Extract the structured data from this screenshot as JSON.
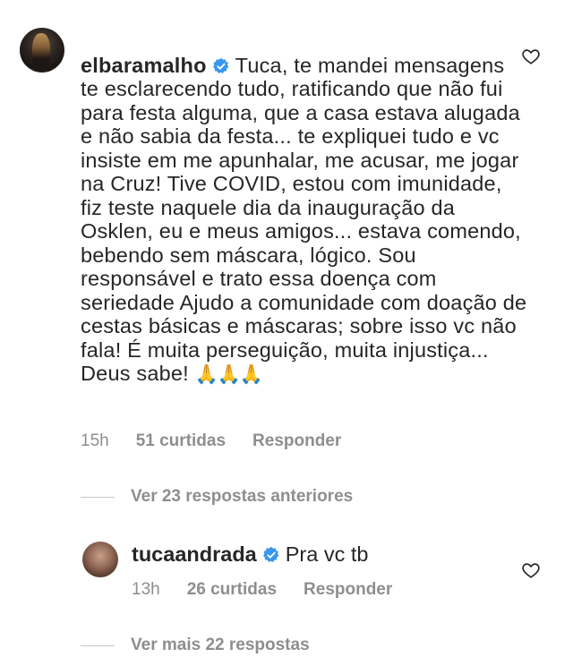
{
  "comment": {
    "username": "elbaramalho",
    "verified": true,
    "text": "Tuca, te mandei mensagens te esclarecendo tudo, ratificando que não fui para festa alguma, que a casa estava alugada e não sabia da festa... te expliquei tudo e vc insiste em me apunhalar, me acusar, me jogar na Cruz! Tive COVID, estou com imunidade, fiz teste naquele dia da inauguração da Osklen, eu e meus amigos... estava comendo, bebendo sem máscara, lógico. Sou responsável e trato essa doença com seriedade Ajudo a comunidade com doação de cestas básicas e máscaras; sobre isso vc não fala! É muita perseguição, muita injustiça... Deus sabe!",
    "emoji": "🙏🙏🙏",
    "time": "15h",
    "likes": "51 curtidas",
    "reply_label": "Responder",
    "like_icon": "heart-outline-icon"
  },
  "view_previous_replies": "Ver 23 respostas anteriores",
  "reply": {
    "username": "tucaandrada",
    "verified": true,
    "text": "Pra vc tb",
    "time": "13h",
    "likes": "26 curtidas",
    "reply_label": "Responder",
    "like_icon": "heart-outline-icon"
  },
  "view_more_replies": "Ver mais 22 respostas",
  "colors": {
    "text": "#262626",
    "muted": "#8e8e8e",
    "verified_badge": "#3897f0"
  }
}
